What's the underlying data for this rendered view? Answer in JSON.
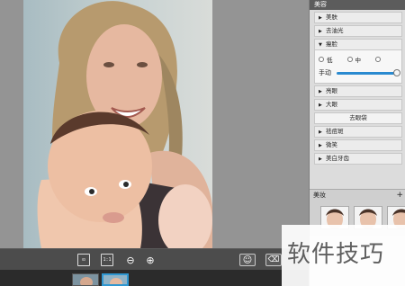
{
  "panel": {
    "title": "美容",
    "sections": [
      {
        "label": "美肤",
        "arrow": "▶"
      },
      {
        "label": "去油光",
        "arrow": "▶"
      },
      {
        "label": "瘦脸",
        "arrow": "▼"
      }
    ],
    "face_options": {
      "radio_1": "低",
      "radio_2": "中",
      "manual_label": "手动",
      "manual_level": 0.95
    },
    "sections_after": [
      {
        "label": "亮眼",
        "arrow": "▶"
      },
      {
        "label": "大眼",
        "arrow": "▶"
      }
    ],
    "remove_eye_bag": "去眼袋",
    "sections_last": [
      {
        "label": "祛痘斑",
        "arrow": "▶"
      },
      {
        "label": "微笑",
        "arrow": "▶"
      },
      {
        "label": "美白牙齿",
        "arrow": "▶"
      }
    ],
    "beauty_collection": {
      "title": "美妆",
      "plus": "+"
    }
  },
  "toolbar": {
    "fit_label": "⊡",
    "one_to_one_label": "1:1",
    "zoom_out": "⊖",
    "zoom_in": "⊕",
    "smile": "☺",
    "eraser": "⌫"
  },
  "watermark": {
    "text": "软件技巧"
  },
  "colors": {
    "accent": "#2a8ad0",
    "panel_bg": "#dcdcdc",
    "toolbar_bg": "#4c4c4c"
  }
}
